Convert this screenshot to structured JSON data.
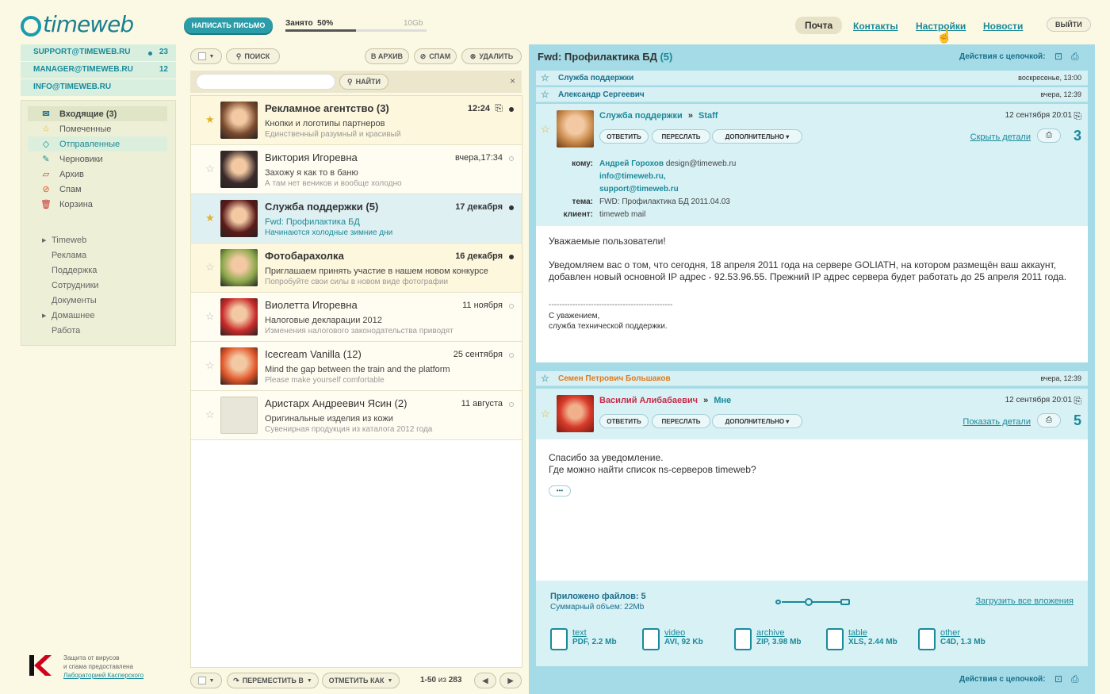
{
  "app": {
    "logo": "timeweb",
    "compose": "НАПИСАТЬ ПИСЬМО",
    "quota_label": "Занято",
    "quota_value": "50%",
    "quota_total": "10Gb",
    "quota_fraction": 0.5
  },
  "nav": {
    "mail": "Почта",
    "contacts": "Контакты",
    "settings": "Настройки",
    "news": "Новости",
    "logout": "ВЫЙТИ"
  },
  "accounts": [
    {
      "name": "SUPPORT@TIMEWEB.RU",
      "count": "23"
    },
    {
      "name": "MANAGER@TIMEWEB.RU",
      "count": "12"
    },
    {
      "name": "INFO@TIMEWEB.RU",
      "count": ""
    }
  ],
  "folders": [
    {
      "label": "Входящие (3)",
      "icon": "inbox-icon",
      "glyph": "✉"
    },
    {
      "label": "Помеченные",
      "icon": "star-icon",
      "glyph": "☆"
    },
    {
      "label": "Отправленные",
      "icon": "sent-icon",
      "glyph": "◇"
    },
    {
      "label": "Черновики",
      "icon": "pencil-icon",
      "glyph": "✎"
    },
    {
      "label": "Архив",
      "icon": "archive-icon",
      "glyph": "▱"
    },
    {
      "label": "Спам",
      "icon": "spam-icon",
      "glyph": "⊘"
    },
    {
      "label": "Корзина",
      "icon": "trash-icon",
      "glyph": "🗑"
    }
  ],
  "labels": [
    {
      "label": "Timeweb",
      "arrow": "▶"
    },
    {
      "label": "Реклама",
      "arrow": ""
    },
    {
      "label": "Поддержка",
      "arrow": ""
    },
    {
      "label": "Сотрудники",
      "arrow": ""
    },
    {
      "label": "Документы",
      "arrow": ""
    },
    {
      "label": "Домашнее",
      "arrow": "▶"
    },
    {
      "label": "Работа",
      "arrow": ""
    }
  ],
  "kaspersky": {
    "line1": "Защита от вирусов",
    "line2": "и спама предоставлена",
    "link": "Лабораторией Касперского"
  },
  "listtools": {
    "search": "ПОИСК",
    "archive": "В АРХИВ",
    "spam": "СПАМ",
    "delete": "УДАЛИТЬ",
    "find": "НАЙТИ",
    "close": "×"
  },
  "messages": [
    {
      "from": "Рекламное агентство (3)",
      "subject": "Кнопки и логотипы партнеров",
      "preview": "Единственный разумный и красивый",
      "date": "12:24",
      "starred": true,
      "bold": true,
      "clip": true,
      "read": false,
      "color": "#7a4a2e"
    },
    {
      "from": "Виктория Игоревна",
      "subject": "Захожу я как то в баню",
      "preview": "А там нет веников и вообще холодно",
      "date": "вчера,17:34",
      "starred": false,
      "bold": false,
      "clip": false,
      "read": true,
      "color": "#3a2a2a"
    },
    {
      "from": "Служба поддержки (5)",
      "subject": "Fwd: Профилактика БД",
      "preview": "Начинаются холодные зимние дни",
      "date": "17 декабря",
      "starred": true,
      "bold": true,
      "clip": false,
      "read": false,
      "color": "#5a1a1a"
    },
    {
      "from": "Фотобарахолка",
      "subject": "Приглашаем принять участие в нашем новом конкурсе",
      "preview": "Попробуйте свои силы в новом виде фотографии",
      "date": "16 декабря",
      "starred": false,
      "bold": true,
      "clip": false,
      "read": false,
      "color": "#8aa84a"
    },
    {
      "from": "Виолетта Игоревна",
      "subject": "Налоговые декларации 2012",
      "preview": "Изменения налогового законодательства приводят",
      "date": "11 ноября",
      "starred": false,
      "bold": false,
      "clip": false,
      "read": true,
      "color": "#c82a2a"
    },
    {
      "from": "Icecream Vanilla (12)",
      "subject": "Mind the gap between the train and the platform",
      "preview": "Please make yourself comfortable",
      "date": "25 сентября",
      "starred": false,
      "bold": false,
      "clip": false,
      "read": true,
      "color": "#e2562a"
    },
    {
      "from": "Аристарх Андреевич Ясин (2)",
      "subject": "Оригинальные изделия из кожи",
      "preview": "Сувенирная продукция из каталога 2012 года",
      "date": "11 августа",
      "starred": false,
      "bold": false,
      "clip": false,
      "read": true,
      "color": "#e8e6d8"
    }
  ],
  "listbottom": {
    "move": "ПЕРЕМЕСТИТЬ В",
    "mark": "ОТМЕТИТЬ КАК",
    "range": "1-50",
    "of": "из",
    "total": "283"
  },
  "thread": {
    "title": "Fwd: Профилактика БД",
    "count": "(5)",
    "actions": "Действия с цепочкой:"
  },
  "collapsed": [
    {
      "from": "Служба поддержки",
      "date": "воскресенье, 13:00"
    },
    {
      "from": "Александр Сергеевич",
      "date": "вчера, 12:39"
    }
  ],
  "card1": {
    "from": "Служба поддержки",
    "sep": "»",
    "to": "Staff",
    "date": "12 сентября 20:01",
    "reply": "ОТВЕТИТЬ",
    "forward": "ПЕРЕСЛАТЬ",
    "more": "ДОПОЛНИТЕЛЬНО",
    "details": "Скрыть детали",
    "num": "3",
    "to_label": "кому:",
    "to_name": "Андрей Горохов",
    "to_email": "design@timeweb.ru",
    "to2": "info@timeweb.ru,",
    "to3": "support@timeweb.ru",
    "subj_label": "тема:",
    "subj": "FWD: Профилактика БД 2011.04.03",
    "client_label": "клиент:",
    "client": "timeweb mail",
    "greeting": "Уважаемые пользователи!",
    "text": "Уведомляем вас о том, что сегодня, 18 апреля 2011 года на сервере GOLIATH, на котором размещён ваш аккаунт, добавлен новый основной IP адрес - 92.53.96.55. Прежний IP адрес сервера будет работать до 25 апреля 2011 года.",
    "dashes": "-----------------------------------------------",
    "sig1": "С уважением,",
    "sig2": "служба технической поддержки."
  },
  "collapsed2": {
    "from": "Семен Петрович Большаков",
    "date": "вчера, 12:39"
  },
  "card2": {
    "from": "Василий Алибабаевич",
    "sep": "»",
    "to": "Мне",
    "date": "12 сентября 20:01",
    "reply": "ОТВЕТИТЬ",
    "forward": "ПЕРЕСЛАТЬ",
    "more": "ДОПОЛНИТЕЛЬНО",
    "details": "Показать детали",
    "num": "5",
    "line1": "Спасибо за уведомление.",
    "line2": "Где можно найти список ns-серверов timeweb?",
    "ellipsis": "•••"
  },
  "attach": {
    "title": "Приложено файлов: 5",
    "size": "Суммарный объем: 22Mb",
    "download": "Загрузить все вложения",
    "files": [
      {
        "name": "text",
        "desc": "PDF, 2.2 Mb"
      },
      {
        "name": "video",
        "desc": "AVI, 92 Kb"
      },
      {
        "name": "archive",
        "desc": "ZIP, 3.98 Mb"
      },
      {
        "name": "table",
        "desc": "XLS, 2.44 Mb"
      },
      {
        "name": "other",
        "desc": "C4D, 1.3 Mb"
      }
    ]
  },
  "colors": {
    "accent": "#1a8a9a",
    "bg": "#fbf8e3",
    "right": "#a4dbe6"
  }
}
